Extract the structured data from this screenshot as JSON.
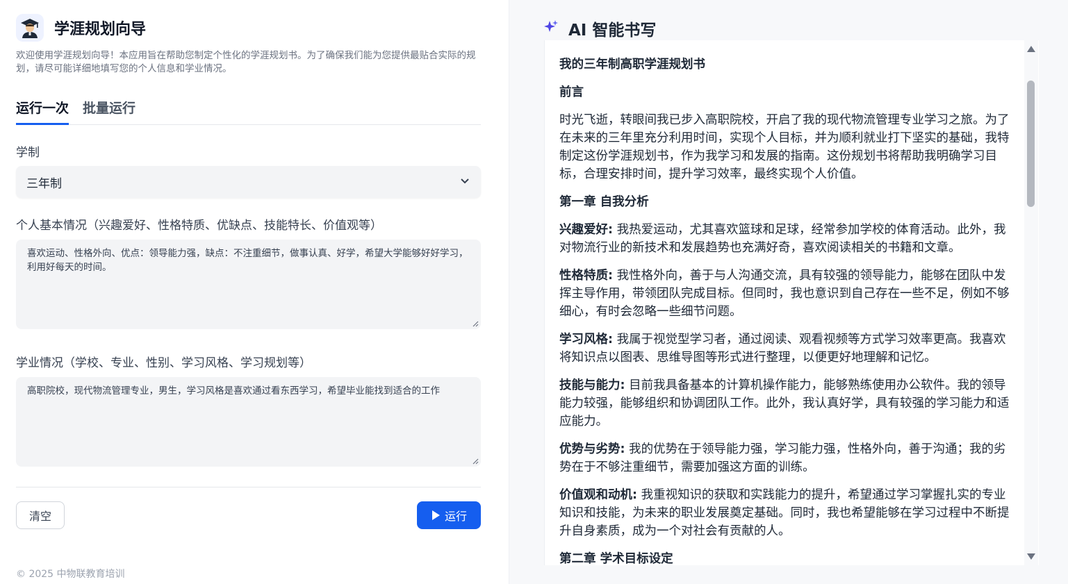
{
  "app": {
    "title": "学涯规划向导",
    "description": "欢迎使用学涯规划向导！本应用旨在帮助您制定个性化的学涯规划书。为了确保我们能为您提供最贴合实际的规划，请尽可能详细地填写您的个人信息和学业情况。",
    "icon": "student-avatar-icon"
  },
  "tabs": [
    {
      "label": "运行一次",
      "active": true
    },
    {
      "label": "批量运行",
      "active": false
    }
  ],
  "form": {
    "school_system": {
      "label": "学制",
      "value": "三年制"
    },
    "personal_info": {
      "label": "个人基本情况（兴趣爱好、性格特质、优缺点、技能特长、价值观等）",
      "value": "喜欢运动、性格外向、优点：领导能力强，缺点：不注重细节，做事认真、好学，希望大学能够好好学习，利用好每天的时间。"
    },
    "academic_info": {
      "label": "学业情况（学校、专业、性别、学习风格、学习规划等）",
      "value": "高职院校，现代物流管理专业，男生，学习风格是喜欢通过看东西学习，希望毕业能找到适合的工作"
    }
  },
  "buttons": {
    "clear": "清空",
    "run": "运行"
  },
  "footer": "© 2025 中物联教育培训",
  "ai": {
    "title": "AI 智能书写",
    "icon": "sparkle-icon",
    "output": {
      "title": "我的三年制高职学涯规划书",
      "preface_heading": "前言",
      "preface": "时光飞逝，转眼间我已步入高职院校，开启了我的现代物流管理专业学习之旅。为了在未来的三年里充分利用时间，实现个人目标，并为顺利就业打下坚实的基础，我特制定这份学涯规划书，作为我学习和发展的指南。这份规划书将帮助我明确学习目标，合理安排时间，提升学习效率，最终实现个人价值。",
      "chapter1_heading": "第一章 自我分析",
      "items": [
        {
          "label": "兴趣爱好:",
          "text": " 我热爱运动，尤其喜欢篮球和足球，经常参加学校的体育活动。此外，我对物流行业的新技术和发展趋势也充满好奇，喜欢阅读相关的书籍和文章。"
        },
        {
          "label": "性格特质:",
          "text": " 我性格外向，善于与人沟通交流，具有较强的领导能力，能够在团队中发挥主导作用，带领团队完成目标。但同时，我也意识到自己存在一些不足，例如不够细心，有时会忽略一些细节问题。"
        },
        {
          "label": "学习风格:",
          "text": " 我属于视觉型学习者，通过阅读、观看视频等方式学习效率更高。我喜欢将知识点以图表、思维导图等形式进行整理，以便更好地理解和记忆。"
        },
        {
          "label": "技能与能力:",
          "text": " 目前我具备基本的计算机操作能力，能够熟练使用办公软件。我的领导能力较强，能够组织和协调团队工作。此外，我认真好学，具有较强的学习能力和适应能力。"
        },
        {
          "label": "优势与劣势:",
          "text": " 我的优势在于领导能力强，学习能力强，性格外向，善于沟通；我的劣势在于不够注重细节，需要加强这方面的训练。"
        },
        {
          "label": "价值观和动机:",
          "text": " 我重视知识的获取和实践能力的提升，希望通过学习掌握扎实的专业知识和技能，为未来的职业发展奠定基础。同时，我也希望能够在学习过程中不断提升自身素质，成为一个对社会有贡献的人。"
        }
      ],
      "chapter2_heading": "第二章 学术目标设定"
    }
  }
}
